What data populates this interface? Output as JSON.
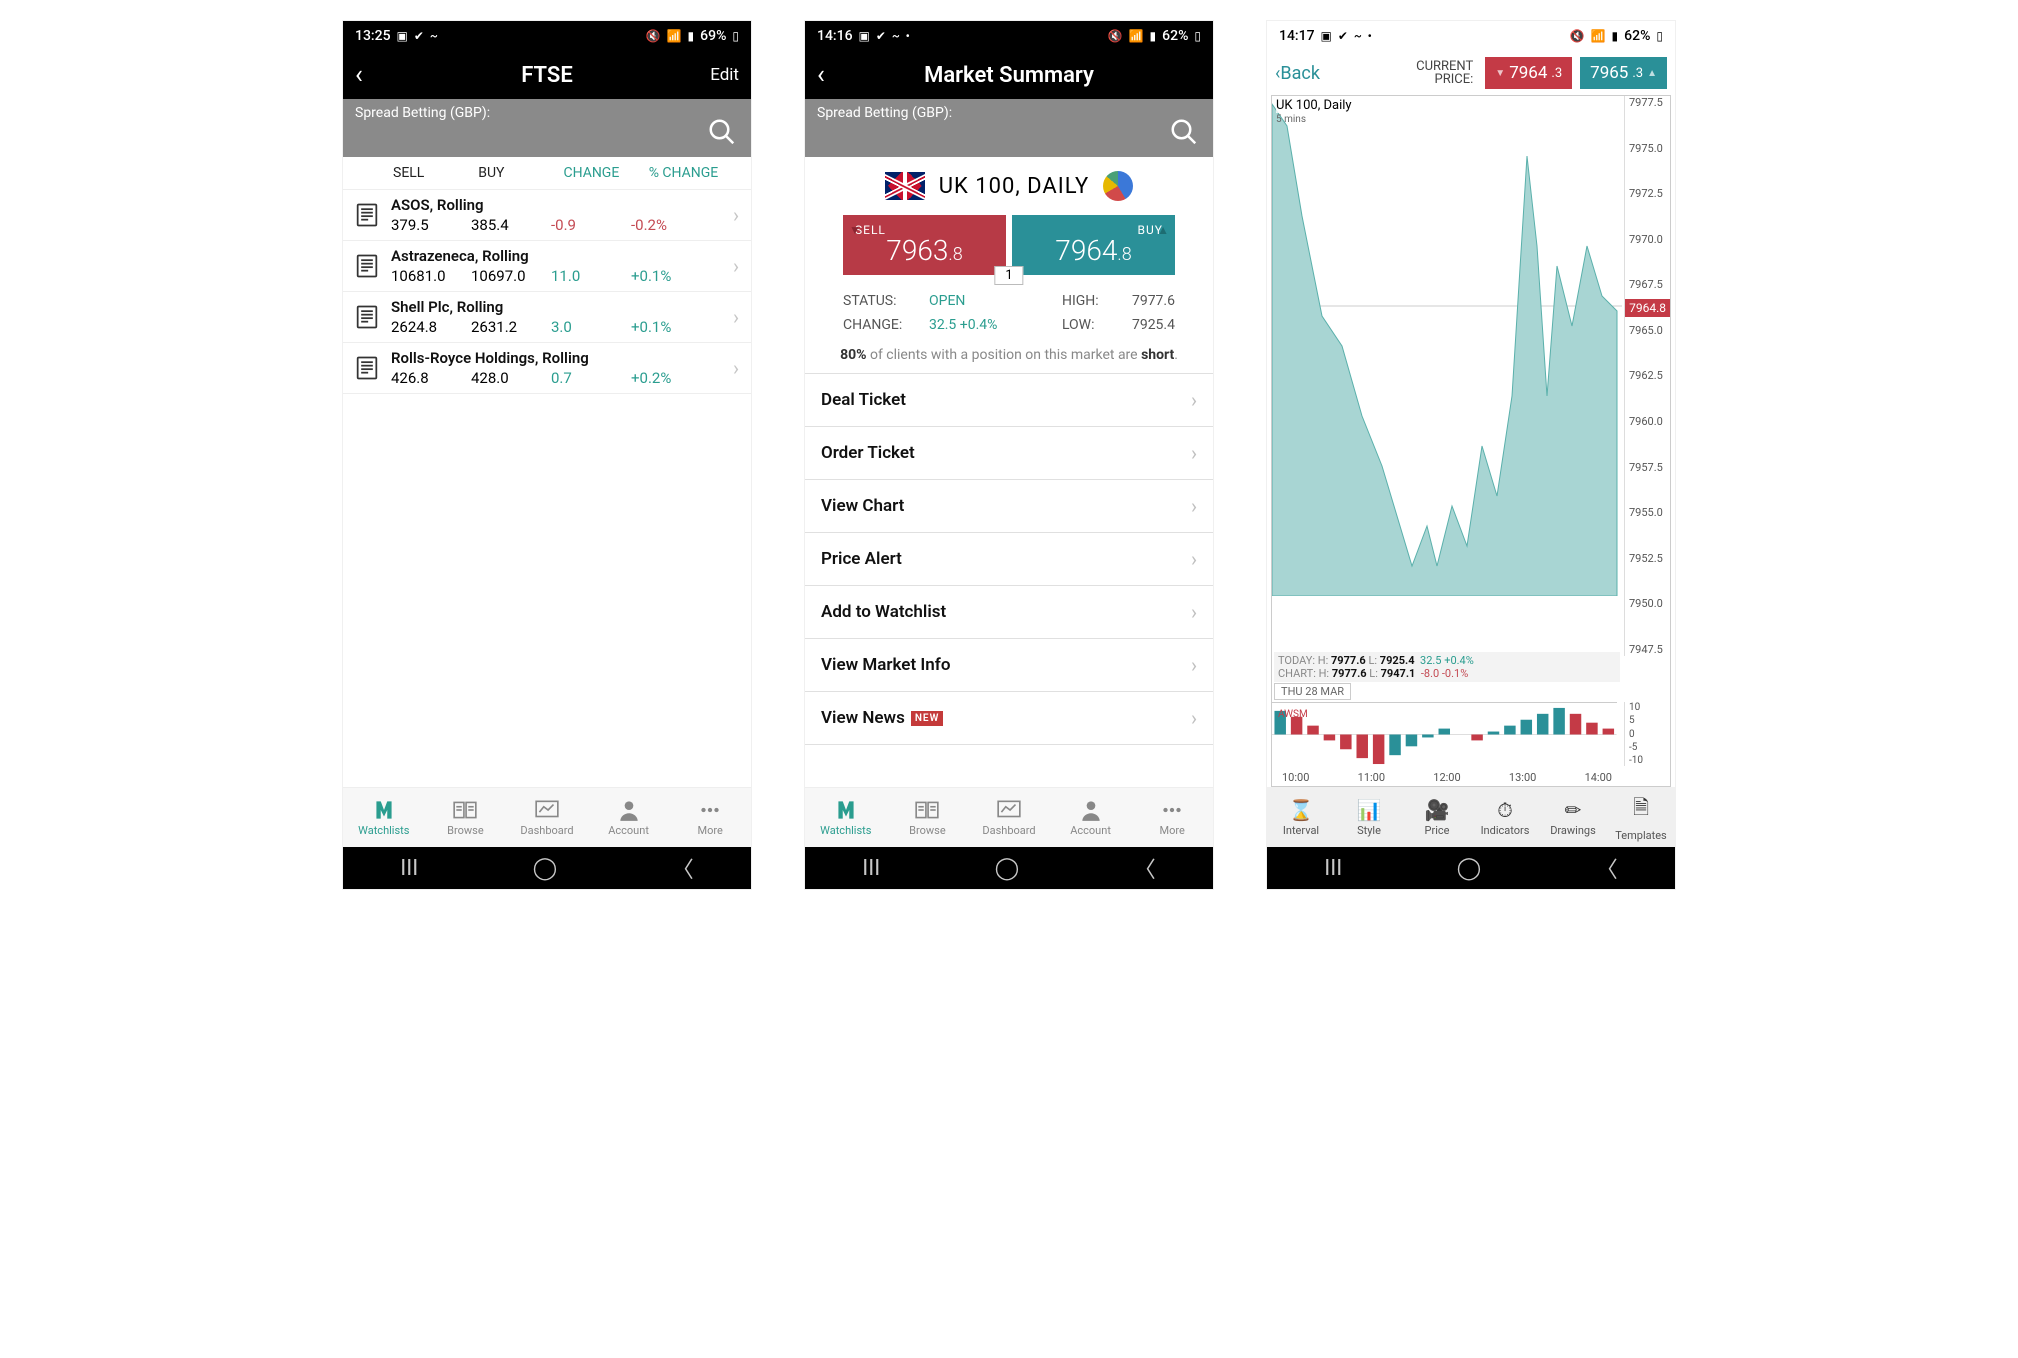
{
  "screen1": {
    "status": {
      "time": "13:25",
      "battery": "69%"
    },
    "header": {
      "title": "FTSE",
      "edit": "Edit"
    },
    "search_label": "Spread Betting (GBP):",
    "cols": {
      "sell": "SELL",
      "buy": "BUY",
      "change": "CHANGE",
      "pct": "% CHANGE"
    },
    "rows": [
      {
        "name": "ASOS, Rolling",
        "sell": "379.5",
        "buy": "385.4",
        "change": "-0.9",
        "pct": "-0.2%",
        "dir": "neg"
      },
      {
        "name": "Astrazeneca, Rolling",
        "sell": "10681.0",
        "buy": "10697.0",
        "change": "11.0",
        "pct": "+0.1%",
        "dir": "pos"
      },
      {
        "name": "Shell Plc, Rolling",
        "sell": "2624.8",
        "buy": "2631.2",
        "change": "3.0",
        "pct": "+0.1%",
        "dir": "pos"
      },
      {
        "name": "Rolls-Royce Holdings, Rolling",
        "sell": "426.8",
        "buy": "428.0",
        "change": "0.7",
        "pct": "+0.2%",
        "dir": "pos"
      }
    ]
  },
  "screen2": {
    "status": {
      "time": "14:16",
      "battery": "62%"
    },
    "header": {
      "title": "Market Summary"
    },
    "search_label": "Spread Betting (GBP):",
    "market_title": "UK 100, DAILY",
    "sell": {
      "label": "SELL",
      "int": "7963",
      "dec": ".8"
    },
    "buy": {
      "label": "BUY",
      "int": "7964",
      "dec": ".8"
    },
    "spread": "1",
    "status_row": {
      "label": "STATUS:",
      "value": "OPEN"
    },
    "high_row": {
      "label": "HIGH:",
      "value": "7977.6"
    },
    "change_row": {
      "label": "CHANGE:",
      "value": "32.5 +0.4%"
    },
    "low_row": {
      "label": "LOW:",
      "value": "7925.4"
    },
    "sentiment": {
      "pct": "80%",
      "mid": " of clients with a position on this market are ",
      "side": "short",
      "end": "."
    },
    "actions": [
      "Deal Ticket",
      "Order Ticket",
      "View Chart",
      "Price Alert",
      "Add to Watchlist",
      "View Market Info",
      "View News"
    ],
    "new_badge": "NEW"
  },
  "screen3": {
    "status": {
      "time": "14:17",
      "battery": "62%"
    },
    "back": "Back",
    "cp_label": "CURRENT\nPRICE:",
    "sell": {
      "int": "7964",
      "dec": ".3"
    },
    "buy": {
      "int": "7965",
      "dec": ".3"
    },
    "chart_title": "UK 100, Daily",
    "chart_sub": "5 mins",
    "price_marker": "7964.8",
    "y_ticks": [
      "7977.5",
      "7975.0",
      "7972.5",
      "7970.0",
      "7967.5",
      "7965.0",
      "7962.5",
      "7960.0",
      "7957.5",
      "7955.0",
      "7952.5",
      "7950.0",
      "7947.5"
    ],
    "sub_y_ticks": [
      "10",
      "5",
      "0",
      "-5",
      "-10"
    ],
    "x_ticks": [
      "10:00",
      "11:00",
      "12:00",
      "13:00",
      "14:00"
    ],
    "today_line": {
      "prefix": "TODAY: H: ",
      "h": "7977.6",
      "lp": "  L: ",
      "l": "7925.4",
      "chg": "32.5",
      "pct": "+0.4%"
    },
    "chart_line": {
      "prefix": "CHART: H: ",
      "h": "7977.6",
      "lp": "  L: ",
      "l": "7947.1",
      "chg": "-8.0",
      "pct": "-0.1%"
    },
    "date": "THU 28 MAR",
    "awsm": "AWSM",
    "tools": [
      "Interval",
      "Style",
      "Price",
      "Indicators",
      "Drawings",
      "Templates"
    ]
  },
  "tabs": [
    "Watchlists",
    "Browse",
    "Dashboard",
    "Account",
    "More"
  ],
  "chart_data": {
    "type": "area",
    "title": "UK 100, Daily",
    "interval": "5 mins",
    "ylim": [
      7947.5,
      7977.5
    ],
    "current": 7964.8,
    "x": [
      "10:00",
      "10:30",
      "11:00",
      "11:30",
      "12:00",
      "12:30",
      "13:00",
      "13:30",
      "13:45",
      "14:00",
      "14:15"
    ],
    "y": [
      7977.0,
      7964.0,
      7957.0,
      7952.0,
      7948.0,
      7951.0,
      7953.0,
      7972.0,
      7958.0,
      7965.0,
      7964.8
    ],
    "indicator": {
      "name": "AWSM",
      "ylim": [
        -10,
        10
      ],
      "values": [
        8,
        6,
        3,
        -2,
        -5,
        -8,
        -10,
        -7,
        -4,
        -1,
        2,
        0,
        -2,
        1,
        3,
        5,
        7,
        9,
        7,
        4,
        2
      ]
    }
  }
}
